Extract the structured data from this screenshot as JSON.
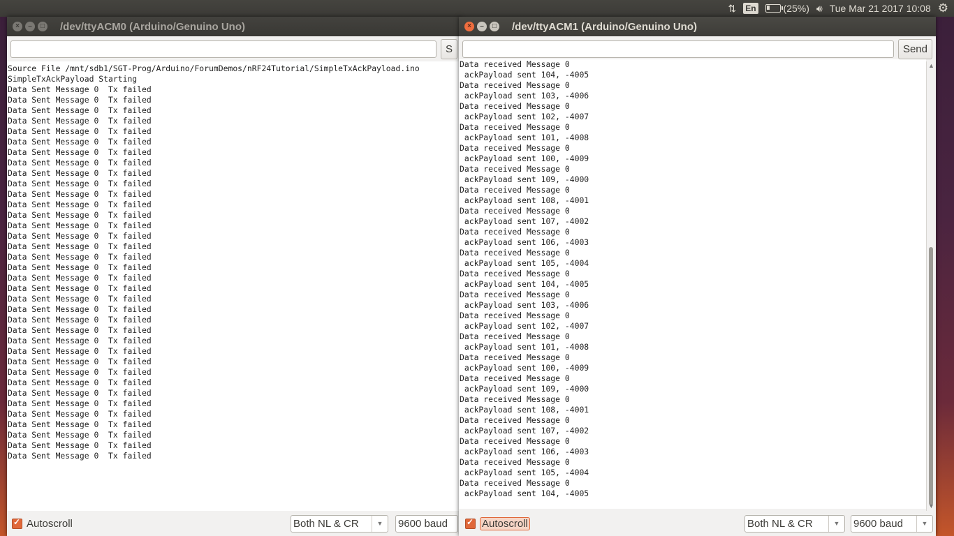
{
  "topbar": {
    "lang": "En",
    "battery": "(25%)",
    "battery_level": 0.25,
    "datetime": "Tue Mar 21 2017 10:08"
  },
  "left_window": {
    "title": "/dev/ttyACM0 (Arduino/Genuino Uno)",
    "send_label": "S",
    "lines": [
      "Source File /mnt/sdb1/SGT-Prog/Arduino/ForumDemos/nRF24Tutorial/SimpleTxAckPayload.ino",
      "SimpleTxAckPayload Starting",
      "Data Sent Message 0  Tx failed",
      "Data Sent Message 0  Tx failed",
      "Data Sent Message 0  Tx failed",
      "Data Sent Message 0  Tx failed",
      "Data Sent Message 0  Tx failed",
      "Data Sent Message 0  Tx failed",
      "Data Sent Message 0  Tx failed",
      "Data Sent Message 0  Tx failed",
      "Data Sent Message 0  Tx failed",
      "Data Sent Message 0  Tx failed",
      "Data Sent Message 0  Tx failed",
      "Data Sent Message 0  Tx failed",
      "Data Sent Message 0  Tx failed",
      "Data Sent Message 0  Tx failed",
      "Data Sent Message 0  Tx failed",
      "Data Sent Message 0  Tx failed",
      "Data Sent Message 0  Tx failed",
      "Data Sent Message 0  Tx failed",
      "Data Sent Message 0  Tx failed",
      "Data Sent Message 0  Tx failed",
      "Data Sent Message 0  Tx failed",
      "Data Sent Message 0  Tx failed",
      "Data Sent Message 0  Tx failed",
      "Data Sent Message 0  Tx failed",
      "Data Sent Message 0  Tx failed",
      "Data Sent Message 0  Tx failed",
      "Data Sent Message 0  Tx failed",
      "Data Sent Message 0  Tx failed",
      "Data Sent Message 0  Tx failed",
      "Data Sent Message 0  Tx failed",
      "Data Sent Message 0  Tx failed",
      "Data Sent Message 0  Tx failed",
      "Data Sent Message 0  Tx failed",
      "Data Sent Message 0  Tx failed",
      "Data Sent Message 0  Tx failed",
      "Data Sent Message 0  Tx failed"
    ],
    "autoscroll_label": "Autoscroll",
    "line_ending": "Both NL & CR",
    "baud": "9600 baud"
  },
  "right_window": {
    "title": "/dev/ttyACM1 (Arduino/Genuino Uno)",
    "send_label": "Send",
    "lines": [
      "Data received Message 0",
      " ackPayload sent 104, -4005",
      "Data received Message 0",
      " ackPayload sent 103, -4006",
      "Data received Message 0",
      " ackPayload sent 102, -4007",
      "Data received Message 0",
      " ackPayload sent 101, -4008",
      "Data received Message 0",
      " ackPayload sent 100, -4009",
      "Data received Message 0",
      " ackPayload sent 109, -4000",
      "Data received Message 0",
      " ackPayload sent 108, -4001",
      "Data received Message 0",
      " ackPayload sent 107, -4002",
      "Data received Message 0",
      " ackPayload sent 106, -4003",
      "Data received Message 0",
      " ackPayload sent 105, -4004",
      "Data received Message 0",
      " ackPayload sent 104, -4005",
      "Data received Message 0",
      " ackPayload sent 103, -4006",
      "Data received Message 0",
      " ackPayload sent 102, -4007",
      "Data received Message 0",
      " ackPayload sent 101, -4008",
      "Data received Message 0",
      " ackPayload sent 100, -4009",
      "Data received Message 0",
      " ackPayload sent 109, -4000",
      "Data received Message 0",
      " ackPayload sent 108, -4001",
      "Data received Message 0",
      " ackPayload sent 107, -4002",
      "Data received Message 0",
      " ackPayload sent 106, -4003",
      "Data received Message 0",
      " ackPayload sent 105, -4004",
      "Data received Message 0",
      " ackPayload sent 104, -4005"
    ],
    "autoscroll_label": "Autoscroll",
    "line_ending": "Both NL & CR",
    "baud": "9600 baud"
  }
}
